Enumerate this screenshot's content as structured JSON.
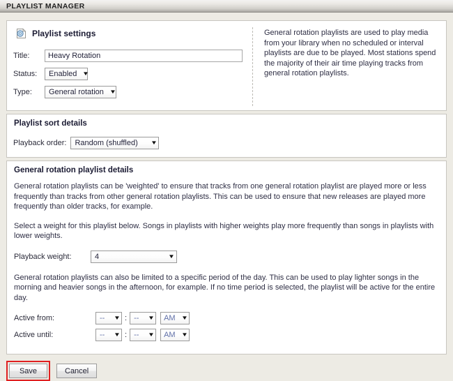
{
  "titlebar": {
    "title": "PLAYLIST MANAGER"
  },
  "settings": {
    "heading": "Playlist settings",
    "icon": "playlist-document-icon",
    "fields": {
      "title": {
        "label": "Title:",
        "value": "Heavy Rotation",
        "placeholder": ""
      },
      "status": {
        "label": "Status:",
        "value": "Enabled"
      },
      "type": {
        "label": "Type:",
        "value": "General rotation"
      }
    },
    "help": "General rotation playlists are used to play media from your library when no scheduled or interval playlists are due to be played. Most stations spend the majority of their air time playing tracks from general rotation playlists."
  },
  "sort": {
    "heading": "Playlist sort details",
    "order": {
      "label": "Playback order:",
      "value": "Random (shuffled)"
    }
  },
  "general_rotation": {
    "heading": "General rotation playlist details",
    "paragraph1": "General rotation playlists can be 'weighted' to ensure that tracks from one general rotation playlist are played more or less frequently than tracks from other general rotation playlists. This can be used to ensure that new releases are played more frequently than older tracks, for example.",
    "paragraph2": "Select a weight for this playlist below. Songs in playlists with higher weights play more frequently than songs in playlists with lower weights.",
    "weight": {
      "label": "Playback weight:",
      "value": "4"
    },
    "paragraph3": "General rotation playlists can also be limited to a specific period of the day. This can be used to play lighter songs in the morning and heavier songs in the afternoon, for example. If no time period is selected, the playlist will be active for the entire day.",
    "active_from": {
      "label": "Active from:",
      "hour": "--",
      "separator": ":",
      "minute": "--",
      "meridiem": "AM"
    },
    "active_until": {
      "label": "Active until:",
      "hour": "--",
      "separator": ":",
      "minute": "--",
      "meridiem": "AM"
    }
  },
  "footer": {
    "save_label": "Save",
    "cancel_label": "Cancel"
  },
  "colors": {
    "page_background": "#edebe4",
    "panel_background": "#ffffff",
    "panel_border": "#c8c6c0",
    "heading_text": "#1b1b33",
    "body_text": "#2e2e44",
    "highlight_outline": "#e02020"
  }
}
